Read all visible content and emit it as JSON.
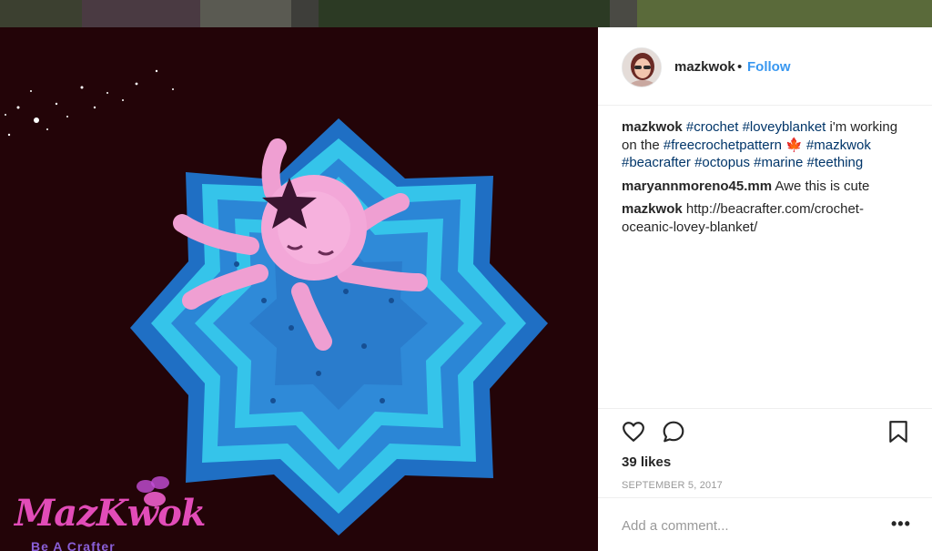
{
  "post": {
    "username": "mazkwok",
    "separator": "•",
    "follow_label": "Follow",
    "likes": "39 likes",
    "date": "SEPTEMBER 5, 2017",
    "add_comment_placeholder": "Add a comment...",
    "more_label": "•••"
  },
  "caption": {
    "user": "mazkwok",
    "parts": [
      {
        "text": "#crochet",
        "tag": true
      },
      {
        "text": " ",
        "tag": false
      },
      {
        "text": "#loveyblanket",
        "tag": true
      },
      {
        "text": " i'm working on the ",
        "tag": false
      },
      {
        "text": "#freecrochetpattern",
        "tag": true
      },
      {
        "text": " 🍁 ",
        "tag": false
      },
      {
        "text": "#mazkwok",
        "tag": true
      },
      {
        "text": " ",
        "tag": false
      },
      {
        "text": "#beacrafter",
        "tag": true
      },
      {
        "text": " ",
        "tag": false
      },
      {
        "text": "#octopus",
        "tag": true
      },
      {
        "text": " ",
        "tag": false
      },
      {
        "text": "#marine",
        "tag": true
      },
      {
        "text": " ",
        "tag": false
      },
      {
        "text": "#teething",
        "tag": true
      }
    ]
  },
  "comments": [
    {
      "user": "maryannmoreno45.mm",
      "text": "Awe this is cute"
    },
    {
      "user": "mazkwok",
      "text": "http://beacrafter.com/crochet-oceanic-lovey-blanket/"
    }
  ],
  "watermark": {
    "title": "MazKwok",
    "subtitle": "Be A Crafter"
  },
  "icons": {
    "like": "heart-icon",
    "comment": "speech-bubble-icon",
    "save": "bookmark-icon",
    "more": "more-options-icon"
  },
  "colors": {
    "link": "#003569",
    "follow": "#3897f0",
    "text": "#262626",
    "muted": "#999999",
    "blanket_dark": "#2e7fcf",
    "blanket_light": "#35c4ea",
    "octopus": "#ef9fd2",
    "star": "#3a1430"
  }
}
